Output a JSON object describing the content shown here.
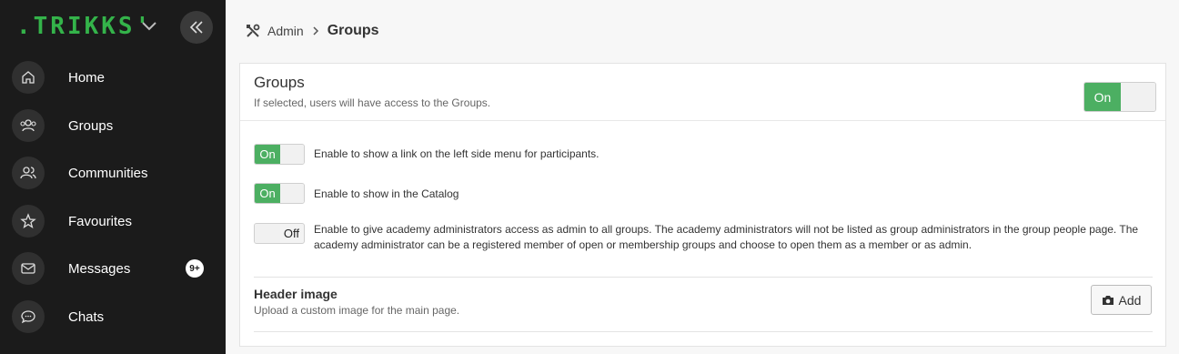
{
  "sidebar": {
    "logo_text": ".TRIKKS'",
    "brand_color": "#34b34a",
    "items": [
      {
        "label": "Home",
        "icon": "home-icon"
      },
      {
        "label": "Groups",
        "icon": "groups-icon"
      },
      {
        "label": "Communities",
        "icon": "communities-icon"
      },
      {
        "label": "Favourites",
        "icon": "star-icon"
      },
      {
        "label": "Messages",
        "icon": "envelope-icon",
        "badge": "9+"
      },
      {
        "label": "Chats",
        "icon": "chat-bubble-icon"
      }
    ]
  },
  "breadcrumb": {
    "icon": "tools-icon",
    "parent": "Admin",
    "current": "Groups"
  },
  "panel": {
    "title": "Groups",
    "description": "If selected, users will have access to the Groups.",
    "main_toggle": {
      "state": "On",
      "on": true
    },
    "options": [
      {
        "state": "On",
        "on": true,
        "text": "Enable to show a link on the left side menu for participants."
      },
      {
        "state": "On",
        "on": true,
        "text": "Enable to show in the Catalog"
      },
      {
        "state": "Off",
        "on": false,
        "text": "Enable to give academy administrators access as admin to all groups. The academy administrators will not be listed as group administrators in the group people page. The academy administrator can be a registered member of open or membership groups and choose to open them as a member or as admin."
      }
    ],
    "header_image": {
      "title": "Header image",
      "description": "Upload a custom image for the main page.",
      "add_label": "Add"
    }
  },
  "colors": {
    "toggle_on": "#4caf62",
    "sidebar_bg": "#1b1b1b"
  }
}
